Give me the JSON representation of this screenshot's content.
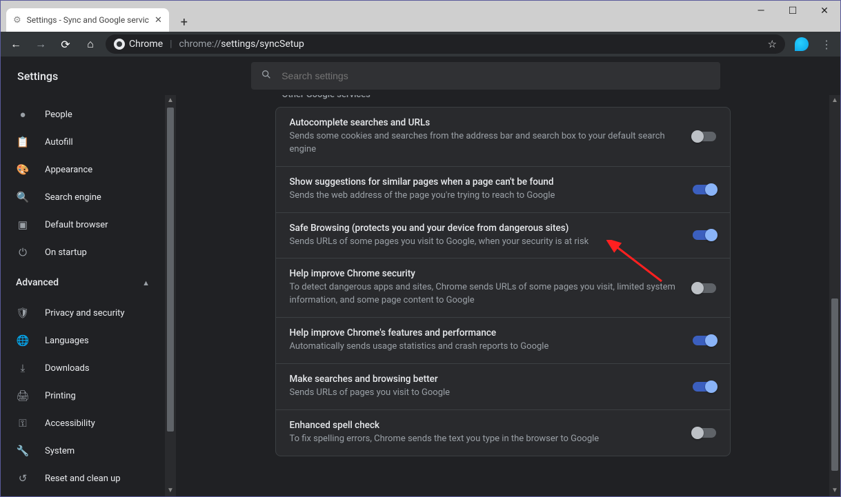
{
  "window": {
    "tab_title": "Settings - Sync and Google servic",
    "url_label": "Chrome",
    "url_prefix": "chrome://",
    "url_path": "settings/syncSetup"
  },
  "header": {
    "title": "Settings",
    "search_placeholder": "Search settings"
  },
  "sidebar": {
    "items_top": [
      {
        "icon": "person",
        "glyph": "●",
        "label": "People"
      },
      {
        "icon": "autofill",
        "glyph": "📋",
        "label": "Autofill"
      },
      {
        "icon": "appearance",
        "glyph": "🎨",
        "label": "Appearance"
      },
      {
        "icon": "search",
        "glyph": "🔍",
        "label": "Search engine"
      },
      {
        "icon": "default-browser",
        "glyph": "▣",
        "label": "Default browser"
      },
      {
        "icon": "startup",
        "glyph": "⏻",
        "label": "On startup"
      }
    ],
    "advanced_label": "Advanced",
    "items_adv": [
      {
        "icon": "privacy",
        "glyph": "🛡",
        "label": "Privacy and security"
      },
      {
        "icon": "languages",
        "glyph": "🌐",
        "label": "Languages"
      },
      {
        "icon": "downloads",
        "glyph": "⤓",
        "label": "Downloads"
      },
      {
        "icon": "printing",
        "glyph": "🖨",
        "label": "Printing"
      },
      {
        "icon": "accessibility",
        "glyph": "⚿",
        "label": "Accessibility"
      },
      {
        "icon": "system",
        "glyph": "🔧",
        "label": "System"
      },
      {
        "icon": "reset",
        "glyph": "↺",
        "label": "Reset and clean up"
      }
    ]
  },
  "section": {
    "title": "Other Google services",
    "rows": [
      {
        "title": "Autocomplete searches and URLs",
        "desc": "Sends some cookies and searches from the address bar and search box to your default search engine",
        "on": false
      },
      {
        "title": "Show suggestions for similar pages when a page can't be found",
        "desc": "Sends the web address of the page you're trying to reach to Google",
        "on": true
      },
      {
        "title": "Safe Browsing (protects you and your device from dangerous sites)",
        "desc": "Sends URLs of some pages you visit to Google, when your security is at risk",
        "on": true
      },
      {
        "title": "Help improve Chrome security",
        "desc": "To detect dangerous apps and sites, Chrome sends URLs of some pages you visit, limited system information, and some page content to Google",
        "on": false
      },
      {
        "title": "Help improve Chrome's features and performance",
        "desc": "Automatically sends usage statistics and crash reports to Google",
        "on": true
      },
      {
        "title": "Make searches and browsing better",
        "desc": "Sends URLs of pages you visit to Google",
        "on": true
      },
      {
        "title": "Enhanced spell check",
        "desc": "To fix spelling errors, Chrome sends the text you type in the browser to Google",
        "on": false
      }
    ]
  }
}
